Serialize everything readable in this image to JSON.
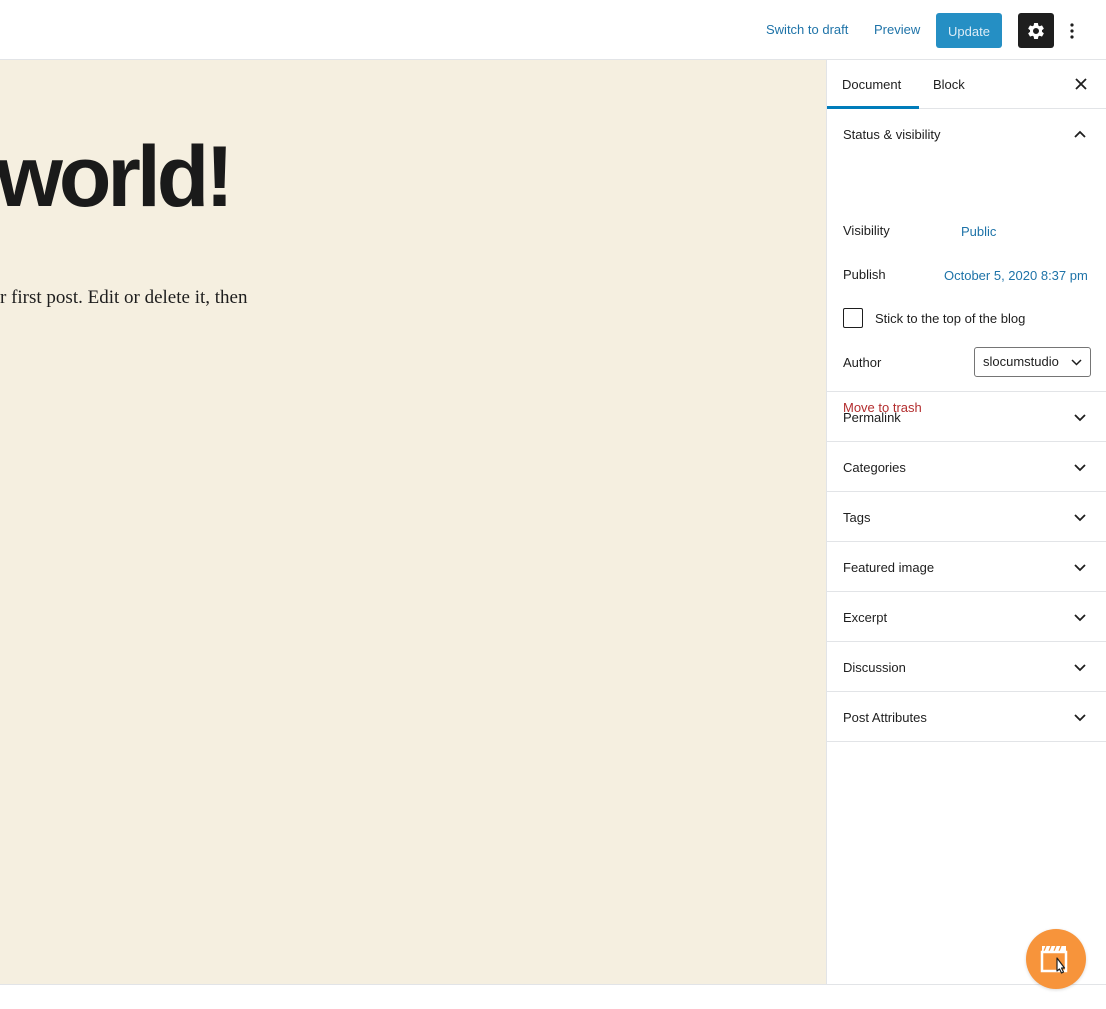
{
  "header": {
    "switch_to_draft": "Switch to draft",
    "preview": "Preview",
    "update": "Update",
    "settings_icon": "gear-icon",
    "more_icon": "vertical-ellipsis-icon"
  },
  "editor": {
    "title": "world!",
    "body": "r first post. Edit or delete it, then",
    "background_color": "#f5efe0"
  },
  "sidebar": {
    "tabs": [
      {
        "label": "Document",
        "active": true
      },
      {
        "label": "Block",
        "active": false
      }
    ],
    "status_visibility": {
      "title": "Status & visibility",
      "visibility_label": "Visibility",
      "visibility_value": "Public",
      "publish_label": "Publish",
      "publish_value": "October 5, 2020 8:37 pm",
      "sticky_label": "Stick to the top of the blog",
      "author_label": "Author",
      "author_value": "slocumstudio",
      "trash_label": "Move to trash"
    },
    "panels": [
      "Permalink",
      "Categories",
      "Tags",
      "Featured image",
      "Excerpt",
      "Discussion",
      "Post Attributes"
    ]
  },
  "colors": {
    "accent": "#007cba",
    "link": "#1e73a8",
    "danger": "#b32d2e",
    "float_button": "#f7943b"
  }
}
